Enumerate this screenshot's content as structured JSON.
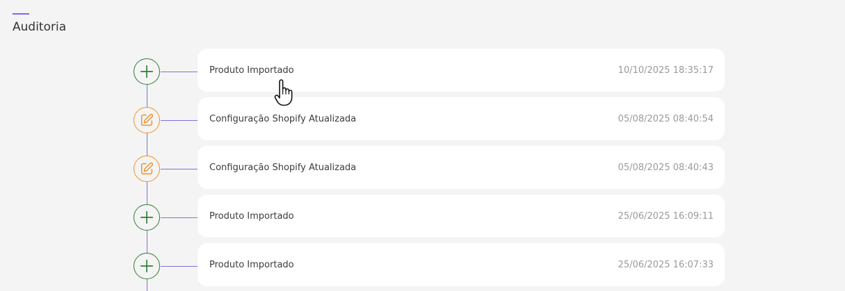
{
  "page": {
    "title": "Auditoria",
    "accent_color": "#7b68ee"
  },
  "timeline": {
    "line_color": "#7b72d9",
    "entries": [
      {
        "type": "add",
        "icon": "plus-icon",
        "color": "#2e7d32",
        "title": "Produto Importado",
        "timestamp": "10/10/2025 18:35:17"
      },
      {
        "type": "edit",
        "icon": "edit-icon",
        "color": "#f0922b",
        "title": "Configuração Shopify Atualizada",
        "timestamp": "05/08/2025 08:40:54"
      },
      {
        "type": "edit",
        "icon": "edit-icon",
        "color": "#f0922b",
        "title": "Configuração Shopify Atualizada",
        "timestamp": "05/08/2025 08:40:43"
      },
      {
        "type": "add",
        "icon": "plus-icon",
        "color": "#2e7d32",
        "title": "Produto Importado",
        "timestamp": "25/06/2025 16:09:11"
      },
      {
        "type": "add",
        "icon": "plus-icon",
        "color": "#2e7d32",
        "title": "Produto Importado",
        "timestamp": "25/06/2025 16:07:33"
      }
    ]
  },
  "cursor": {
    "icon": "hand-pointer-cursor"
  }
}
